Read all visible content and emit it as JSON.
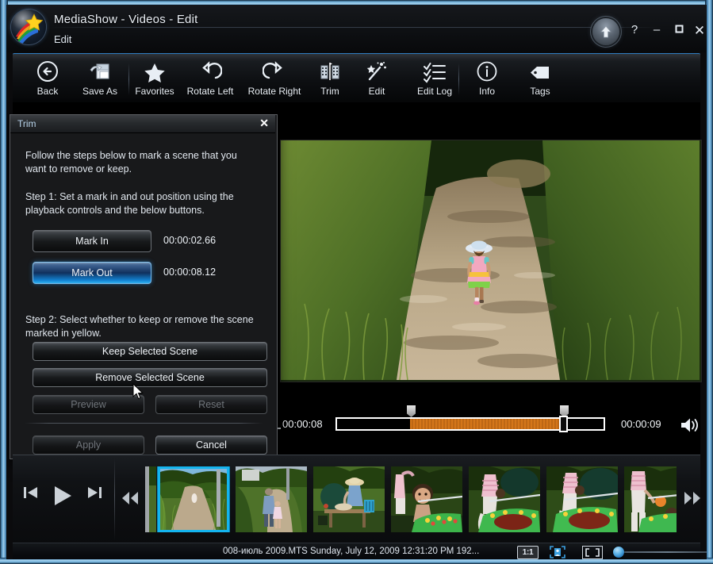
{
  "window": {
    "title": "MediaShow - Videos - Edit",
    "subtitle": "Edit",
    "logo_icon": "rainbow-star-logo",
    "upload_icon": "upload-arrow-icon",
    "help_label": "?",
    "minimize_label": "–",
    "maximize_label": "☐",
    "close_label": "✕"
  },
  "toolbar": {
    "items": [
      {
        "label": "Back",
        "icon": "back-arrow-icon"
      },
      {
        "label": "Save As",
        "icon": "save-as-icon"
      },
      {
        "label": "Favorites",
        "icon": "star-icon"
      },
      {
        "label": "Rotate Left",
        "icon": "rotate-left-icon"
      },
      {
        "label": "Rotate Right",
        "icon": "rotate-right-icon"
      },
      {
        "label": "Trim",
        "icon": "film-trim-icon"
      },
      {
        "label": "Edit",
        "icon": "magic-wand-icon"
      },
      {
        "label": "Edit Log",
        "icon": "checklist-icon"
      },
      {
        "label": "Info",
        "icon": "info-circle-icon"
      },
      {
        "label": "Tags",
        "icon": "tag-icon"
      }
    ]
  },
  "dialog": {
    "title": "Trim",
    "close_label": "✕",
    "intro": "Follow the steps below to mark a scene that you want to remove or keep.",
    "step1": "Step 1: Set a mark in and out position using the playback controls and the below buttons.",
    "step2": "Step 2: Select whether to keep or remove the scene marked in yellow.",
    "mark_in_label": "Mark In",
    "mark_in_time": "00:00:02.66",
    "mark_out_label": "Mark Out",
    "mark_out_time": "00:00:08.12",
    "keep_label": "Keep Selected Scene",
    "remove_label": "Remove Selected Scene",
    "preview_label": "Preview",
    "reset_label": "Reset",
    "apply_label": "Apply",
    "cancel_label": "Cancel"
  },
  "player": {
    "time_current": "00:00:08",
    "time_total": "00:00:09",
    "volume_icon": "speaker-icon",
    "selection_color": "#c96f18",
    "mark_in_handle": "mark-in-handle",
    "mark_out_handle": "mark-out-handle"
  },
  "filmstrip": {
    "prev_label": "skip-back",
    "play_label": "play",
    "next_label": "skip-forward",
    "scroll_left_label": "scroll-left",
    "scroll_right_label": "scroll-right",
    "selected_index": 1,
    "thumbnails": [
      {
        "name": "thumb-partial-left",
        "scene": "path"
      },
      {
        "name": "thumb-path-girl",
        "scene": "path-selected"
      },
      {
        "name": "thumb-woman-child",
        "scene": "walk"
      },
      {
        "name": "thumb-garden-table",
        "scene": "garden"
      },
      {
        "name": "thumb-pool-child",
        "scene": "pool1"
      },
      {
        "name": "thumb-pool-splash",
        "scene": "pool2"
      },
      {
        "name": "thumb-pool-bend",
        "scene": "pool3"
      },
      {
        "name": "thumb-pool-pour",
        "scene": "pool4"
      }
    ]
  },
  "statusbar": {
    "file_info": "008-июль 2009.MTS  Sunday, July 12, 2009 12:31:20 PM  192...",
    "zoom_actual_label": "1:1",
    "face_icon": "face-tag-icon",
    "fit_icon": "fit-to-window-icon",
    "zoom_slider_label": "zoom-slider"
  },
  "colors": {
    "accent_blue": "#14b4ee",
    "selection_orange": "#c96f18",
    "marker_yellow": "#d8af32",
    "frame_blue": "#5ea0cf"
  }
}
